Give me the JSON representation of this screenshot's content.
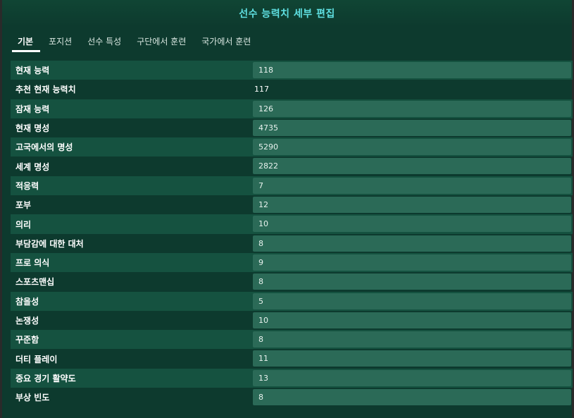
{
  "window": {
    "title": "선수 능력치 세부 편집"
  },
  "tabs": [
    {
      "label": "기본",
      "active": true
    },
    {
      "label": "포지션",
      "active": false
    },
    {
      "label": "선수 특성",
      "active": false
    },
    {
      "label": "구단에서 훈련",
      "active": false
    },
    {
      "label": "국가에서 훈련",
      "active": false
    }
  ],
  "attributes": [
    {
      "label": "현재 능력",
      "value": "118",
      "editable": true
    },
    {
      "label": "추천 현재 능력치",
      "value": "117",
      "editable": false
    },
    {
      "label": "잠재 능력",
      "value": "126",
      "editable": true
    },
    {
      "label": "현재 명성",
      "value": "4735",
      "editable": true
    },
    {
      "label": "고국에서의 명성",
      "value": "5290",
      "editable": true
    },
    {
      "label": "세계 명성",
      "value": "2822",
      "editable": true
    },
    {
      "label": "적응력",
      "value": "7",
      "editable": true
    },
    {
      "label": "포부",
      "value": "12",
      "editable": true
    },
    {
      "label": "의리",
      "value": "10",
      "editable": true
    },
    {
      "label": "부담감에 대한 대처",
      "value": "8",
      "editable": true
    },
    {
      "label": "프로 의식",
      "value": "9",
      "editable": true
    },
    {
      "label": "스포츠맨십",
      "value": "8",
      "editable": true
    },
    {
      "label": "참을성",
      "value": "5",
      "editable": true
    },
    {
      "label": "논쟁성",
      "value": "10",
      "editable": true
    },
    {
      "label": "꾸준함",
      "value": "8",
      "editable": true
    },
    {
      "label": "더티 플레이",
      "value": "11",
      "editable": true
    },
    {
      "label": "중요 경기 활약도",
      "value": "13",
      "editable": true
    },
    {
      "label": "부상 빈도",
      "value": "8",
      "editable": true
    }
  ]
}
